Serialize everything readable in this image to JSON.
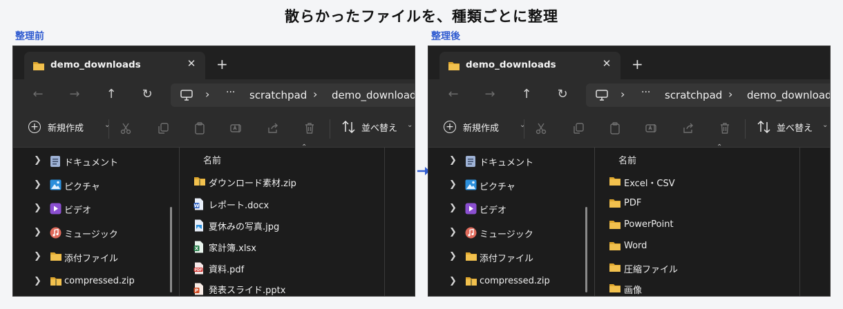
{
  "page_title": "散らかったファイルを、種類ごとに整理",
  "before": {
    "label": "整理前",
    "tab_title": "demo_downloads",
    "breadcrumb": [
      "scratchpad",
      "demo_downloads"
    ],
    "toolbar": {
      "new_label": "新規作成",
      "sort_label": "並べ替え"
    },
    "sidebar": [
      {
        "label": "ドキュメント",
        "icon": "document-icon"
      },
      {
        "label": "ピクチャ",
        "icon": "picture-icon"
      },
      {
        "label": "ビデオ",
        "icon": "video-icon"
      },
      {
        "label": "ミュージック",
        "icon": "music-icon"
      },
      {
        "label": "添付ファイル",
        "icon": "folder-icon"
      },
      {
        "label": "compressed.zip",
        "icon": "zip-folder-icon"
      }
    ],
    "column_header": "名前",
    "files": [
      {
        "label": "ダウンロード素材.zip",
        "icon": "zip-folder-icon"
      },
      {
        "label": "レポート.docx",
        "icon": "word-file-icon"
      },
      {
        "label": "夏休みの写真.jpg",
        "icon": "image-file-icon"
      },
      {
        "label": "家計簿.xlsx",
        "icon": "excel-file-icon"
      },
      {
        "label": "資料.pdf",
        "icon": "pdf-file-icon"
      },
      {
        "label": "発表スライド.pptx",
        "icon": "powerpoint-file-icon"
      }
    ]
  },
  "after": {
    "label": "整理後",
    "tab_title": "demo_downloads",
    "breadcrumb": [
      "scratchpad",
      "demo_downloads"
    ],
    "toolbar": {
      "new_label": "新規作成",
      "sort_label": "並べ替え"
    },
    "sidebar": [
      {
        "label": "ドキュメント",
        "icon": "document-icon"
      },
      {
        "label": "ピクチャ",
        "icon": "picture-icon"
      },
      {
        "label": "ビデオ",
        "icon": "video-icon"
      },
      {
        "label": "ミュージック",
        "icon": "music-icon"
      },
      {
        "label": "添付ファイル",
        "icon": "folder-icon"
      },
      {
        "label": "compressed.zip",
        "icon": "zip-folder-icon"
      }
    ],
    "column_header": "名前",
    "files": [
      {
        "label": "Excel・CSV",
        "icon": "folder-icon"
      },
      {
        "label": "PDF",
        "icon": "folder-icon"
      },
      {
        "label": "PowerPoint",
        "icon": "folder-icon"
      },
      {
        "label": "Word",
        "icon": "folder-icon"
      },
      {
        "label": "圧縮ファイル",
        "icon": "folder-icon"
      },
      {
        "label": "画像",
        "icon": "folder-icon"
      }
    ]
  },
  "colors": {
    "label_blue": "#2f5bd0",
    "window_bg": "#202020",
    "folder_yellow": "#f2c14e",
    "arrow_blue": "#2f5bd0"
  }
}
